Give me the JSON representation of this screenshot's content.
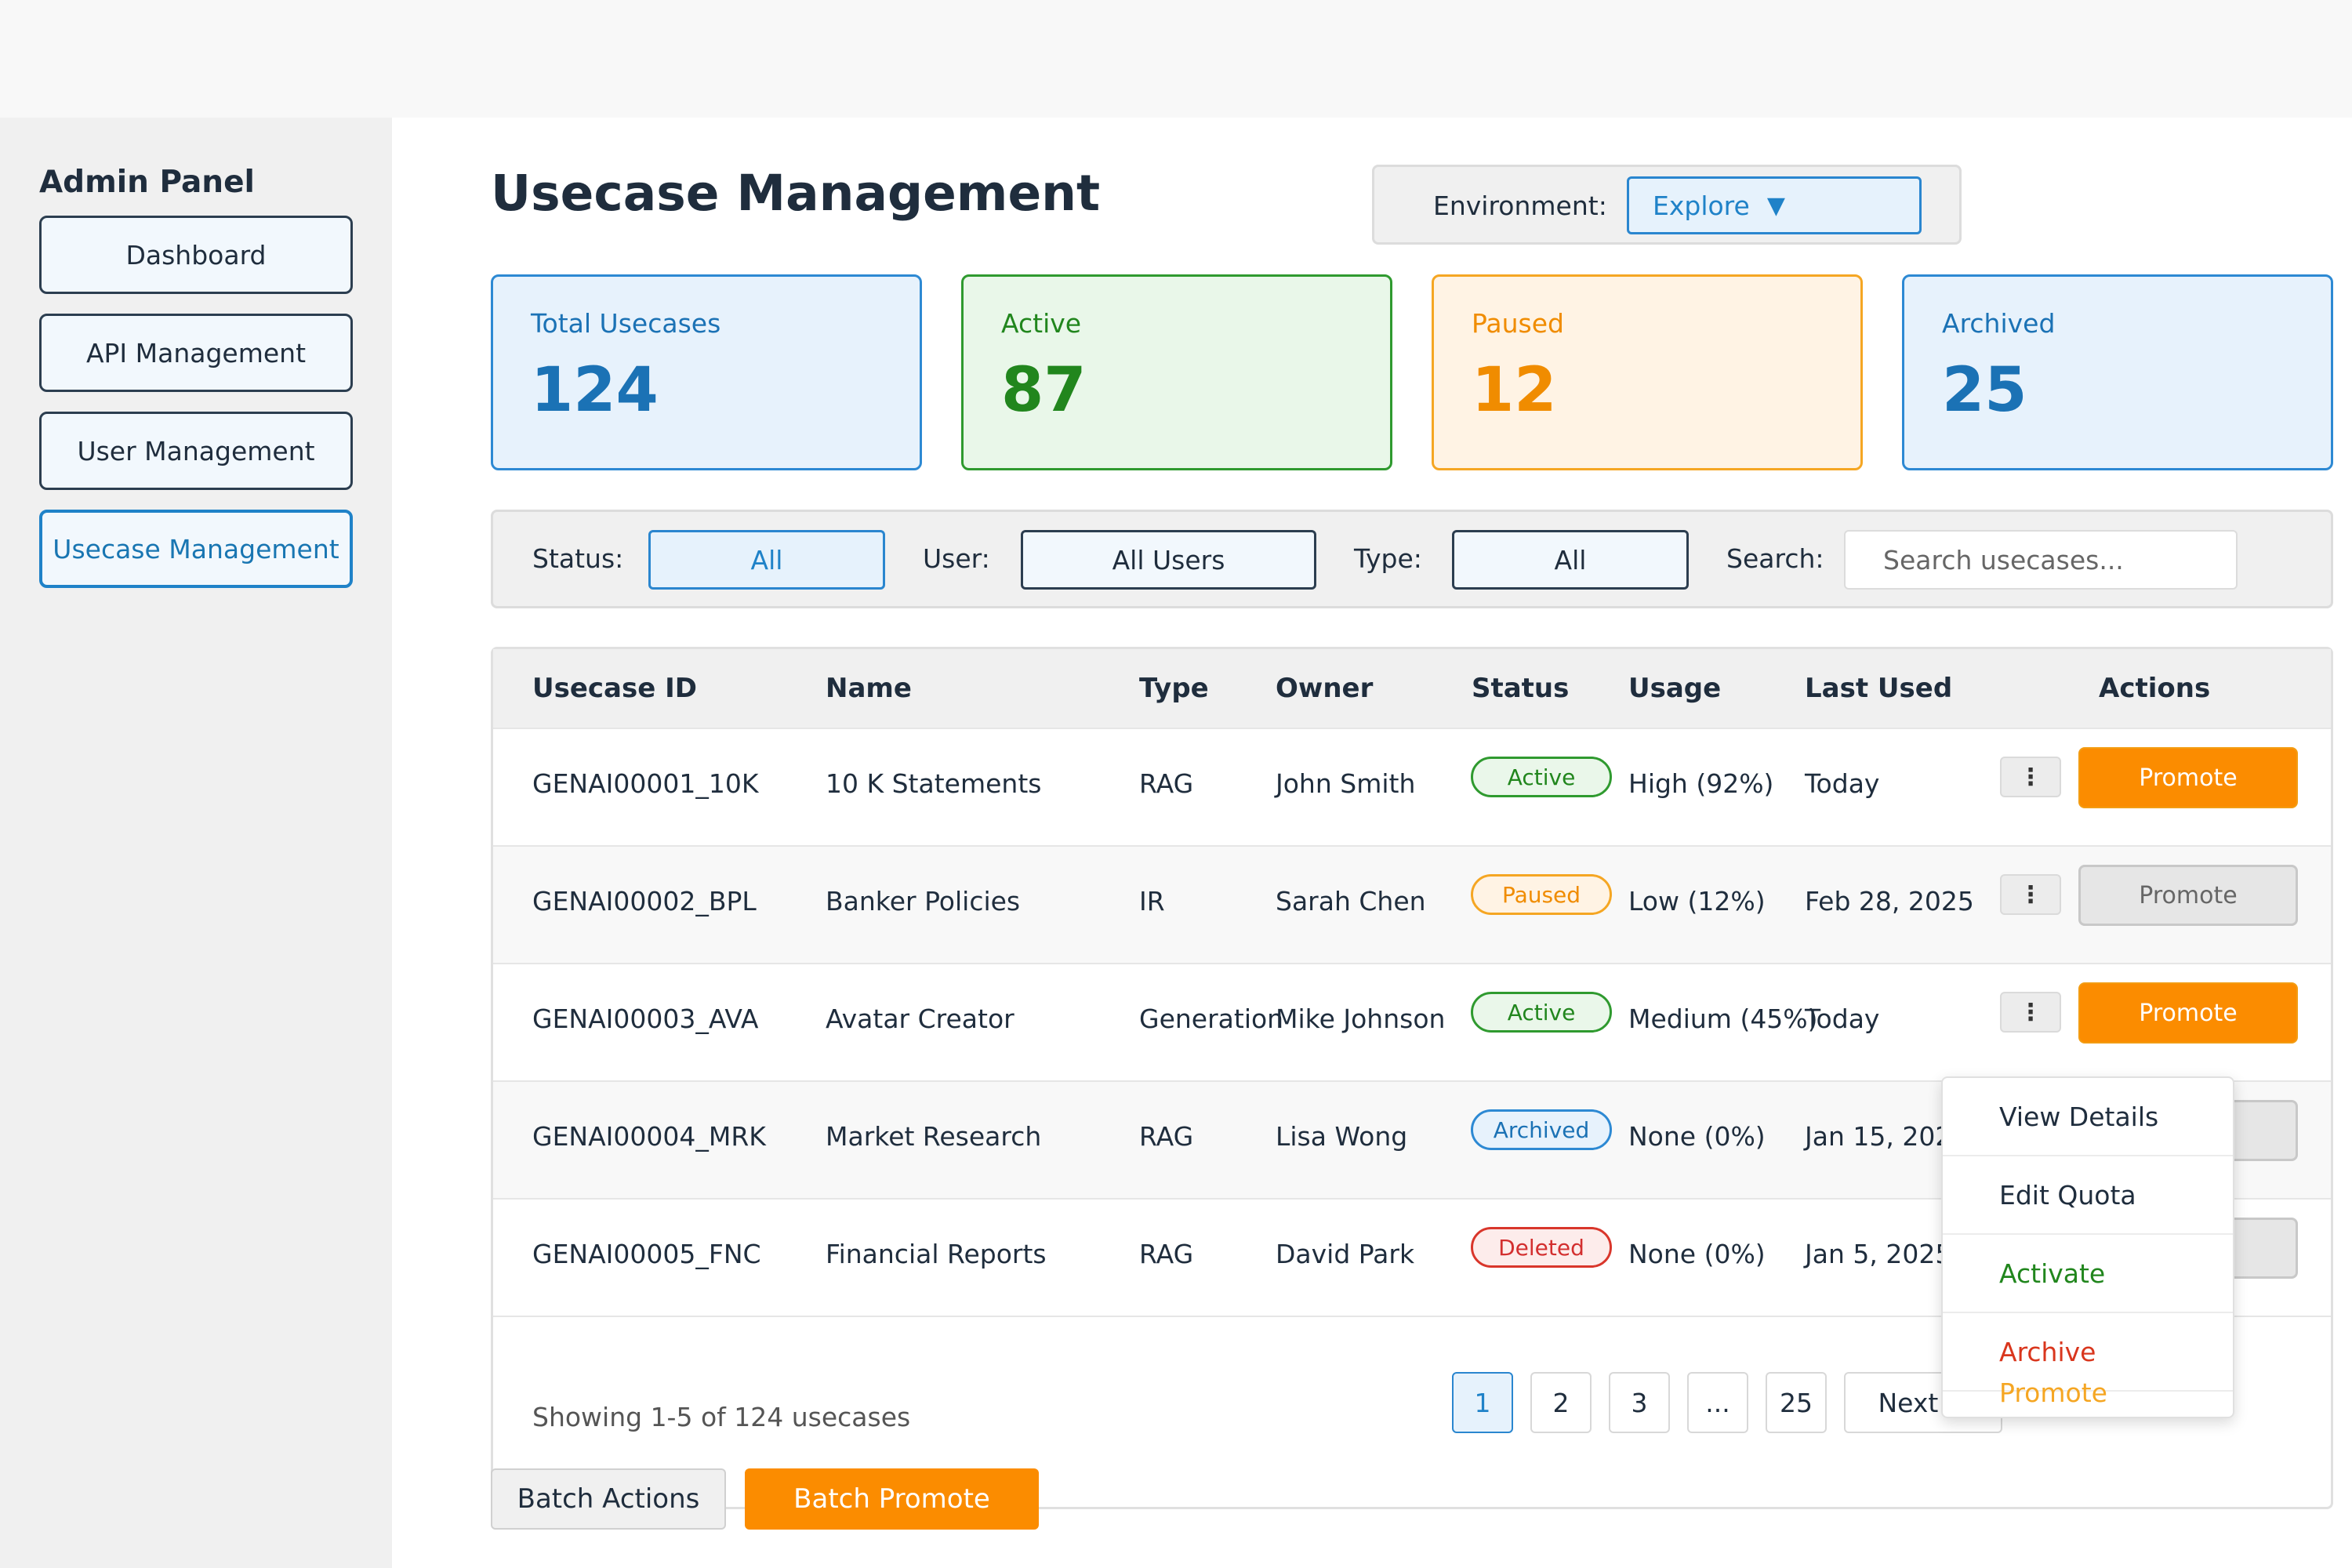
{
  "sidebar": {
    "title": "Admin Panel",
    "items": [
      {
        "label": "Dashboard"
      },
      {
        "label": "API Management"
      },
      {
        "label": "User Management"
      },
      {
        "label": "Usecase Management"
      }
    ]
  },
  "header": {
    "title": "Usecase Management",
    "environment_label": "Environment:",
    "environment_value": "Explore",
    "environment_arrow": "▼"
  },
  "stats": {
    "total": {
      "label": "Total Usecases",
      "value": "124"
    },
    "active": {
      "label": "Active",
      "value": "87"
    },
    "paused": {
      "label": "Paused",
      "value": "12"
    },
    "archived": {
      "label": "Archived",
      "value": "25"
    }
  },
  "filters": {
    "status_label": "Status:",
    "status_value": "All",
    "user_label": "User:",
    "user_value": "All Users",
    "type_label": "Type:",
    "type_value": "All",
    "search_label": "Search:",
    "search_placeholder": "Search usecases..."
  },
  "table": {
    "columns": [
      "Usecase ID",
      "Name",
      "Type",
      "Owner",
      "Status",
      "Usage",
      "Last Used",
      "Actions"
    ],
    "rows": [
      {
        "id": "GENAI00001_10K",
        "name": "10 K Statements",
        "type": "RAG",
        "owner": "John Smith",
        "status": "Active",
        "usage": "High (92%)",
        "last_used": "Today",
        "kebab": "⋮",
        "promote": "Promote"
      },
      {
        "id": "GENAI00002_BPL",
        "name": "Banker Policies",
        "type": "IR",
        "owner": "Sarah Chen",
        "status": "Paused",
        "usage": "Low (12%)",
        "last_used": "Feb 28, 2025",
        "kebab": "⋮",
        "promote": "Promote"
      },
      {
        "id": "GENAI00003_AVA",
        "name": "Avatar Creator",
        "type": "Generation",
        "owner": "Mike Johnson",
        "status": "Active",
        "usage": "Medium (45%)",
        "last_used": "Today",
        "kebab": "⋮",
        "promote": "Promote"
      },
      {
        "id": "GENAI00004_MRK",
        "name": "Market Research",
        "type": "RAG",
        "owner": "Lisa Wong",
        "status": "Archived",
        "usage": "None (0%)",
        "last_used": "Jan 15, 202"
      },
      {
        "id": "GENAI00005_FNC",
        "name": "Financial Reports",
        "type": "RAG",
        "owner": "David Park",
        "status": "Deleted",
        "usage": "None (0%)",
        "last_used": "Jan 5, 2025"
      }
    ]
  },
  "pagination": {
    "summary": "Showing 1-5 of 124 usecases",
    "pages": [
      "1",
      "2",
      "3",
      "...",
      "25"
    ],
    "next": "Next →"
  },
  "batch": {
    "actions_label": "Batch Actions",
    "promote_label": "Batch Promote"
  },
  "dropdown": {
    "items": [
      "View Details",
      "Edit Quota",
      "Activate",
      "Archive",
      "Promote"
    ]
  },
  "colors": {
    "accent_blue": "#1f82c8",
    "active_green": "#21861d",
    "paused_orange": "#f08c00",
    "deleted_red": "#d32f2f",
    "promote_orange": "#fb8c00"
  }
}
